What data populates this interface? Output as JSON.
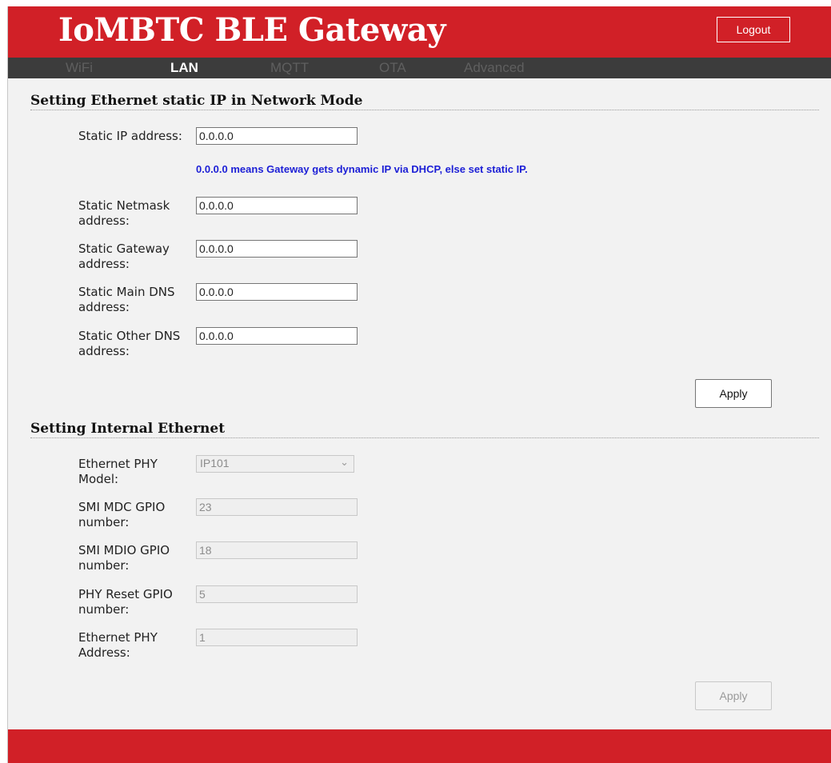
{
  "app": {
    "title": "IoMBTC BLE Gateway",
    "logout_label": "Logout"
  },
  "nav": {
    "tabs": [
      {
        "label": "WiFi",
        "active": false
      },
      {
        "label": "LAN",
        "active": true
      },
      {
        "label": "MQTT",
        "active": false
      },
      {
        "label": "OTA",
        "active": false
      },
      {
        "label": "Advanced",
        "active": false
      }
    ]
  },
  "static_ip": {
    "title": "Setting Ethernet static IP in Network Mode",
    "fields": [
      {
        "label": "Static IP address:",
        "value": "0.0.0.0"
      },
      {
        "label": "Static Netmask address:",
        "value": "0.0.0.0"
      },
      {
        "label": "Static Gateway address:",
        "value": "0.0.0.0"
      },
      {
        "label": "Static Main DNS address:",
        "value": "0.0.0.0"
      },
      {
        "label": "Static Other DNS address:",
        "value": "0.0.0.0"
      }
    ],
    "hint": "0.0.0.0 means Gateway gets dynamic IP via DHCP, else set static IP.",
    "apply_label": "Apply"
  },
  "internal_eth": {
    "title": "Setting Internal Ethernet",
    "phy_model": {
      "label": "Ethernet PHY Model:",
      "value": "IP101"
    },
    "fields": [
      {
        "label": "SMI MDC GPIO number:",
        "value": "23"
      },
      {
        "label": "SMI MDIO GPIO number:",
        "value": "18"
      },
      {
        "label": "PHY Reset GPIO number:",
        "value": "5"
      },
      {
        "label": "Ethernet PHY Address:",
        "value": "1"
      }
    ],
    "apply_label": "Apply"
  },
  "colors": {
    "brand_red": "#d12027",
    "nav_bg": "#3c3c3c",
    "hint_blue": "#1c1fd6",
    "page_bg": "#f2f2f2"
  }
}
